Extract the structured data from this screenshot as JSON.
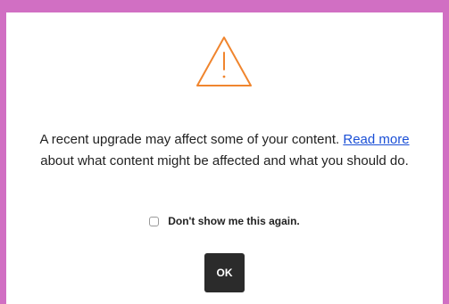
{
  "dialog": {
    "icon": "warning-triangle-icon",
    "message_before_link": "A recent upgrade may affect some of your content. ",
    "link_text": "Read more",
    "message_after_link": " about what content might be affected and what you should do.",
    "checkbox_label": "Don't show me this again.",
    "checkbox_checked": false,
    "ok_label": "OK"
  },
  "colors": {
    "background": "#d16fc3",
    "warning_icon": "#f0852e",
    "link": "#1a4fd6",
    "button": "#2b2b2b"
  }
}
